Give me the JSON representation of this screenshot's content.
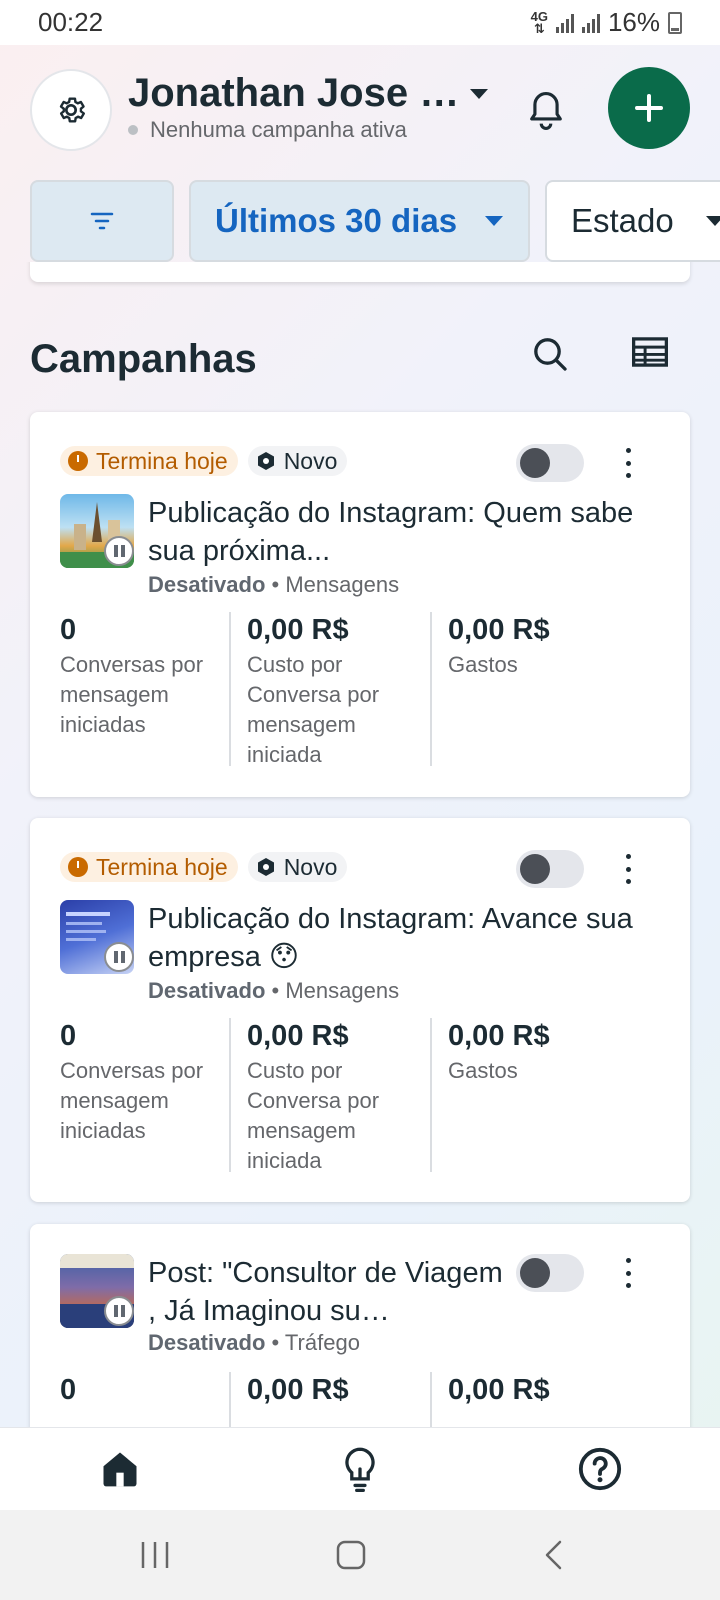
{
  "status_bar": {
    "time": "00:22",
    "network": "4G",
    "battery": "16%"
  },
  "header": {
    "account_name": "Jonathan Jose …",
    "account_status": "Nenhuma campanha ativa"
  },
  "filters": {
    "date_range": "Últimos 30 dias",
    "state": "Estado"
  },
  "section": {
    "title": "Campanhas"
  },
  "campaigns": [
    {
      "badge_ends": "Termina hoje",
      "badge_new": "Novo",
      "title": "Publicação do Instagram: Quem sabe sua próxima...",
      "status": "Desativado",
      "objective": "• Mensagens",
      "metrics": [
        {
          "value": "0",
          "label": "Conversas por mensagem iniciadas"
        },
        {
          "value": "0,00 R$",
          "label": "Custo por Conversa por mensagem iniciada"
        },
        {
          "value": "0,00 R$",
          "label": "Gastos"
        }
      ]
    },
    {
      "badge_ends": "Termina hoje",
      "badge_new": "Novo",
      "title": "Publicação do Instagram: Avance sua empresa 😯",
      "status": "Desativado",
      "objective": "• Mensagens",
      "metrics": [
        {
          "value": "0",
          "label": "Conversas por mensagem iniciadas"
        },
        {
          "value": "0,00 R$",
          "label": "Custo por Conversa por mensagem iniciada"
        },
        {
          "value": "0,00 R$",
          "label": "Gastos"
        }
      ]
    },
    {
      "title": "Post: \"Consultor de Viagem , Já Imaginou su…",
      "status": "Desativado",
      "objective": "• Tráfego",
      "metrics": [
        {
          "value": "0"
        },
        {
          "value": "0,00 R$"
        },
        {
          "value": "0,00 R$"
        }
      ]
    }
  ],
  "colors": {
    "accent_green": "#0a6b4a",
    "accent_blue": "#1565c0",
    "warning": "#b35c00"
  },
  "icons": {
    "header": [
      "gear-icon",
      "bell-icon",
      "plus-icon"
    ],
    "bottom_nav": [
      "home-icon",
      "lightbulb-icon",
      "help-icon"
    ]
  }
}
